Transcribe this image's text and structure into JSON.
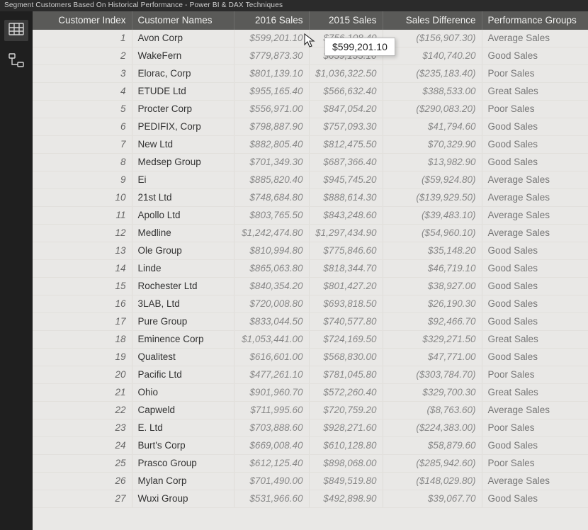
{
  "window": {
    "title": "Segment Customers Based On Historical Performance - Power BI & DAX Techniques"
  },
  "columns": {
    "index": "Customer Index",
    "name": "Customer Names",
    "sales2016": "2016 Sales",
    "sales2015": "2015 Sales",
    "diff": "Sales Difference",
    "group": "Performance Groups"
  },
  "tooltip": {
    "value": "$599,201.10"
  },
  "rows": [
    {
      "idx": "1",
      "name": "Avon Corp",
      "s2016": "$599,201.10",
      "s2015": "$756,108.40",
      "diff": "($156,907.30)",
      "group": "Average Sales"
    },
    {
      "idx": "2",
      "name": "WakeFern",
      "s2016": "$779,873.30",
      "s2015": "$639,133.10",
      "diff": "$140,740.20",
      "group": "Good Sales"
    },
    {
      "idx": "3",
      "name": "Elorac, Corp",
      "s2016": "$801,139.10",
      "s2015": "$1,036,322.50",
      "diff": "($235,183.40)",
      "group": "Poor Sales"
    },
    {
      "idx": "4",
      "name": "ETUDE Ltd",
      "s2016": "$955,165.40",
      "s2015": "$566,632.40",
      "diff": "$388,533.00",
      "group": "Great Sales"
    },
    {
      "idx": "5",
      "name": "Procter Corp",
      "s2016": "$556,971.00",
      "s2015": "$847,054.20",
      "diff": "($290,083.20)",
      "group": "Poor Sales"
    },
    {
      "idx": "6",
      "name": "PEDIFIX, Corp",
      "s2016": "$798,887.90",
      "s2015": "$757,093.30",
      "diff": "$41,794.60",
      "group": "Good Sales"
    },
    {
      "idx": "7",
      "name": "New Ltd",
      "s2016": "$882,805.40",
      "s2015": "$812,475.50",
      "diff": "$70,329.90",
      "group": "Good Sales"
    },
    {
      "idx": "8",
      "name": "Medsep Group",
      "s2016": "$701,349.30",
      "s2015": "$687,366.40",
      "diff": "$13,982.90",
      "group": "Good Sales"
    },
    {
      "idx": "9",
      "name": "Ei",
      "s2016": "$885,820.40",
      "s2015": "$945,745.20",
      "diff": "($59,924.80)",
      "group": "Average Sales"
    },
    {
      "idx": "10",
      "name": "21st Ltd",
      "s2016": "$748,684.80",
      "s2015": "$888,614.30",
      "diff": "($139,929.50)",
      "group": "Average Sales"
    },
    {
      "idx": "11",
      "name": "Apollo Ltd",
      "s2016": "$803,765.50",
      "s2015": "$843,248.60",
      "diff": "($39,483.10)",
      "group": "Average Sales"
    },
    {
      "idx": "12",
      "name": "Medline",
      "s2016": "$1,242,474.80",
      "s2015": "$1,297,434.90",
      "diff": "($54,960.10)",
      "group": "Average Sales"
    },
    {
      "idx": "13",
      "name": "Ole Group",
      "s2016": "$810,994.80",
      "s2015": "$775,846.60",
      "diff": "$35,148.20",
      "group": "Good Sales"
    },
    {
      "idx": "14",
      "name": "Linde",
      "s2016": "$865,063.80",
      "s2015": "$818,344.70",
      "diff": "$46,719.10",
      "group": "Good Sales"
    },
    {
      "idx": "15",
      "name": "Rochester Ltd",
      "s2016": "$840,354.20",
      "s2015": "$801,427.20",
      "diff": "$38,927.00",
      "group": "Good Sales"
    },
    {
      "idx": "16",
      "name": "3LAB, Ltd",
      "s2016": "$720,008.80",
      "s2015": "$693,818.50",
      "diff": "$26,190.30",
      "group": "Good Sales"
    },
    {
      "idx": "17",
      "name": "Pure Group",
      "s2016": "$833,044.50",
      "s2015": "$740,577.80",
      "diff": "$92,466.70",
      "group": "Good Sales"
    },
    {
      "idx": "18",
      "name": "Eminence Corp",
      "s2016": "$1,053,441.00",
      "s2015": "$724,169.50",
      "diff": "$329,271.50",
      "group": "Great Sales"
    },
    {
      "idx": "19",
      "name": "Qualitest",
      "s2016": "$616,601.00",
      "s2015": "$568,830.00",
      "diff": "$47,771.00",
      "group": "Good Sales"
    },
    {
      "idx": "20",
      "name": "Pacific Ltd",
      "s2016": "$477,261.10",
      "s2015": "$781,045.80",
      "diff": "($303,784.70)",
      "group": "Poor Sales"
    },
    {
      "idx": "21",
      "name": "Ohio",
      "s2016": "$901,960.70",
      "s2015": "$572,260.40",
      "diff": "$329,700.30",
      "group": "Great Sales"
    },
    {
      "idx": "22",
      "name": "Capweld",
      "s2016": "$711,995.60",
      "s2015": "$720,759.20",
      "diff": "($8,763.60)",
      "group": "Average Sales"
    },
    {
      "idx": "23",
      "name": "E. Ltd",
      "s2016": "$703,888.60",
      "s2015": "$928,271.60",
      "diff": "($224,383.00)",
      "group": "Poor Sales"
    },
    {
      "idx": "24",
      "name": "Burt's Corp",
      "s2016": "$669,008.40",
      "s2015": "$610,128.80",
      "diff": "$58,879.60",
      "group": "Good Sales"
    },
    {
      "idx": "25",
      "name": "Prasco Group",
      "s2016": "$612,125.40",
      "s2015": "$898,068.00",
      "diff": "($285,942.60)",
      "group": "Poor Sales"
    },
    {
      "idx": "26",
      "name": "Mylan Corp",
      "s2016": "$701,490.00",
      "s2015": "$849,519.80",
      "diff": "($148,029.80)",
      "group": "Average Sales"
    },
    {
      "idx": "27",
      "name": "Wuxi Group",
      "s2016": "$531,966.60",
      "s2015": "$492,898.90",
      "diff": "$39,067.70",
      "group": "Good Sales"
    }
  ]
}
